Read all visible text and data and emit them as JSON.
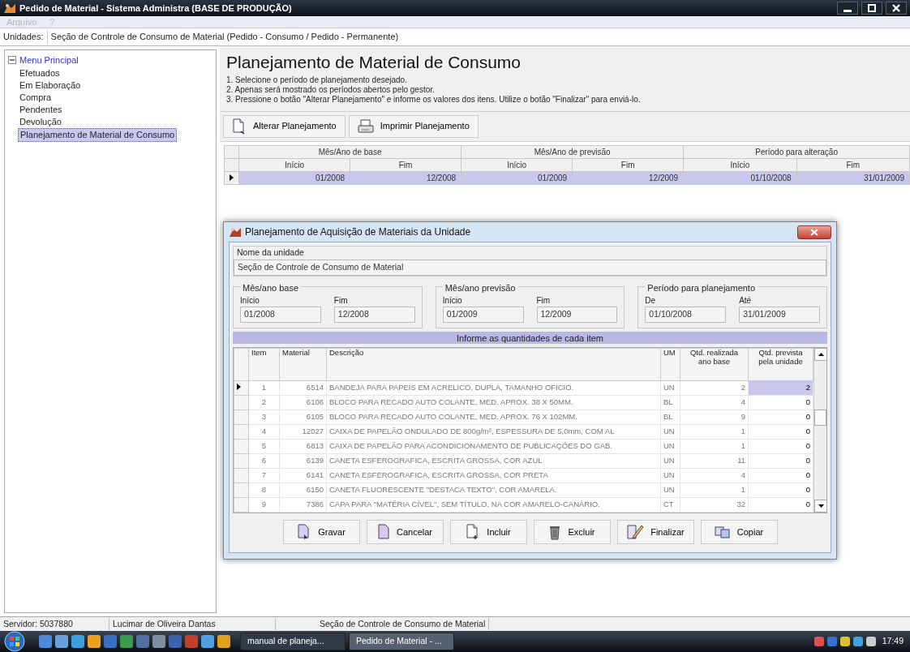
{
  "window": {
    "title": "Pedido de Material - Sistema Administra (BASE DE PRODUÇÃO)"
  },
  "menu": [
    {
      "label": "Arquivo",
      "disabled": true
    },
    {
      "label": "?",
      "disabled": true
    }
  ],
  "unidades": {
    "label": "Unidades:",
    "value": "Seção de Controle de Consumo de Material (Pedido - Consumo / Pedido - Permanente)"
  },
  "tree": {
    "label": "Menu Principal",
    "expanded": true,
    "children": [
      {
        "label": "Efetuados",
        "selected": false
      },
      {
        "label": "Em Elaboração",
        "selected": false
      },
      {
        "label": "Compra",
        "selected": false
      },
      {
        "label": "Pendentes",
        "selected": false
      },
      {
        "label": "Devolução",
        "selected": false
      },
      {
        "label": "Planejamento de Material de Consumo",
        "selected": true
      }
    ]
  },
  "page": {
    "title": "Planejamento de Material de Consumo",
    "steps": [
      "1. Selecione o período de planejamento desejado.",
      "2. Apenas será mostrado os períodos abertos pelo gestor.",
      "3. Pressione o botão \"Alterar Planejamento\" e informe os valores dos itens. Utilize o botão \"Finalizar\" para enviá-lo."
    ],
    "buttons": [
      {
        "label": "Alterar Planejamento",
        "kind": "edit"
      },
      {
        "label": "Imprimir Planejamento",
        "kind": "print"
      }
    ]
  },
  "periods": {
    "groups": [
      "Mês/Ano de base",
      "Mês/Ano de previsão",
      "Período para alteração"
    ],
    "columns": [
      "Início",
      "Fim",
      "Início",
      "Fim",
      "Início",
      "Fim"
    ],
    "rows": [
      {
        "selected": true,
        "cells": [
          "01/2008",
          "12/2008",
          "01/2009",
          "12/2009",
          "01/10/2008",
          "31/01/2009"
        ]
      }
    ]
  },
  "dialog": {
    "title": "Planejamento de Aquisição de Materiais da Unidade",
    "unit_label": "Nome da unidade",
    "unit_value": "Seção de Controle de Consumo de Material",
    "groups": [
      {
        "title": "Mês/ano base",
        "fields": [
          {
            "label": "Início",
            "value": "01/2008"
          },
          {
            "label": "Fim",
            "value": "12/2008"
          }
        ]
      },
      {
        "title": "Mês/ano previsão",
        "fields": [
          {
            "label": "Início",
            "value": "01/2009"
          },
          {
            "label": "Fim",
            "value": "12/2009"
          }
        ]
      },
      {
        "title": "Período para planejamento",
        "fields": [
          {
            "label": "De",
            "value": "01/10/2008"
          },
          {
            "label": "Até",
            "value": "31/01/2009"
          }
        ]
      }
    ],
    "grid_caption": "Informe as quantidades de cada item",
    "columns": [
      "Item",
      "Material",
      "Descrição",
      "UM",
      "Qtd. realizada ano base",
      "Qtd. prevista pela unidade"
    ],
    "rows": [
      {
        "selected": true,
        "cells": [
          "1",
          "6514",
          "BANDEJA PARA PAPEIS EM ACRELICO, DUPLA, TAMANHO OFICIO.",
          "UN",
          "2",
          "2"
        ]
      },
      {
        "selected": false,
        "cells": [
          "2",
          "6106",
          "BLOCO PARA RECADO AUTO COLANTE, MED. APROX. 38 X 50MM.",
          "BL",
          "4",
          "0"
        ]
      },
      {
        "selected": false,
        "cells": [
          "3",
          "6105",
          "BLOCO PARA RECADO AUTO COLANTE, MED. APROX. 76 X 102MM.",
          "BL",
          "9",
          "0"
        ]
      },
      {
        "selected": false,
        "cells": [
          "4",
          "12027",
          "CAIXA DE PAPELÃO ONDULADO DE 800g/m², ESPESSURA DE 5,0mm, COM AL",
          "UN",
          "1",
          "0"
        ]
      },
      {
        "selected": false,
        "cells": [
          "5",
          "6813",
          "CAIXA DE PAPELÃO PARA ACONDICIONAMENTO DE PUBLICAÇÕES DO GAB.",
          "UN",
          "1",
          "0"
        ]
      },
      {
        "selected": false,
        "cells": [
          "6",
          "6139",
          "CANETA ESFEROGRAFICA, ESCRITA GROSSA, COR AZUL",
          "UN",
          "11",
          "0"
        ]
      },
      {
        "selected": false,
        "cells": [
          "7",
          "6141",
          "CANETA ESFEROGRAFICA, ESCRITA GROSSA, COR PRETA",
          "UN",
          "4",
          "0"
        ]
      },
      {
        "selected": false,
        "cells": [
          "8",
          "6150",
          "CANETA FLUORESCENTE \"DESTACA TEXTO\", COR AMARELA.",
          "UN",
          "1",
          "0"
        ]
      },
      {
        "selected": false,
        "cells": [
          "9",
          "7386",
          "CAPA PARA \"MATÉRIA CÍVEL\", SEM TÍTULO, NA COR AMARELO-CANÁRIO.",
          "CT",
          "32",
          "0"
        ]
      }
    ],
    "buttons": [
      {
        "label": "Gravar",
        "kind": "save"
      },
      {
        "label": "Cancelar",
        "kind": "cancel"
      },
      {
        "label": "Incluir",
        "kind": "add"
      },
      {
        "label": "Excluir",
        "kind": "delete"
      },
      {
        "label": "Finalizar",
        "kind": "finish"
      },
      {
        "label": "Copiar",
        "kind": "copy"
      }
    ]
  },
  "status_bar": [
    "Servidor: 5037880",
    "Lucimar de Oliveira Dantas",
    "Seção de Controle de Consumo de Material"
  ],
  "taskbar": {
    "tasks": [
      {
        "label": "manual de planeja...",
        "selected": false
      },
      {
        "label": "Pedido de Material - ...",
        "selected": true
      }
    ],
    "clock": "17:49"
  }
}
